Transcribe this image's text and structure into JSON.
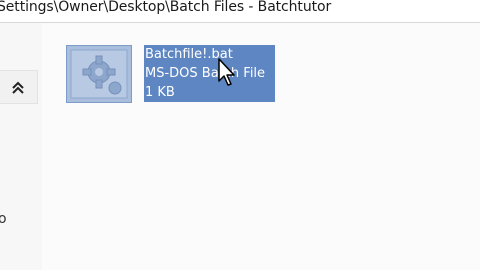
{
  "window": {
    "title": "Settings\\Owner\\Desktop\\Batch Files - Batchtutor"
  },
  "left_pane": {
    "glyph": "o"
  },
  "file": {
    "name": "Batchfile!.bat",
    "type": "MS-DOS Batch File",
    "size": "1 KB"
  },
  "colors": {
    "selection": "#5e86c2",
    "icon_fill": "#a9bedc"
  }
}
